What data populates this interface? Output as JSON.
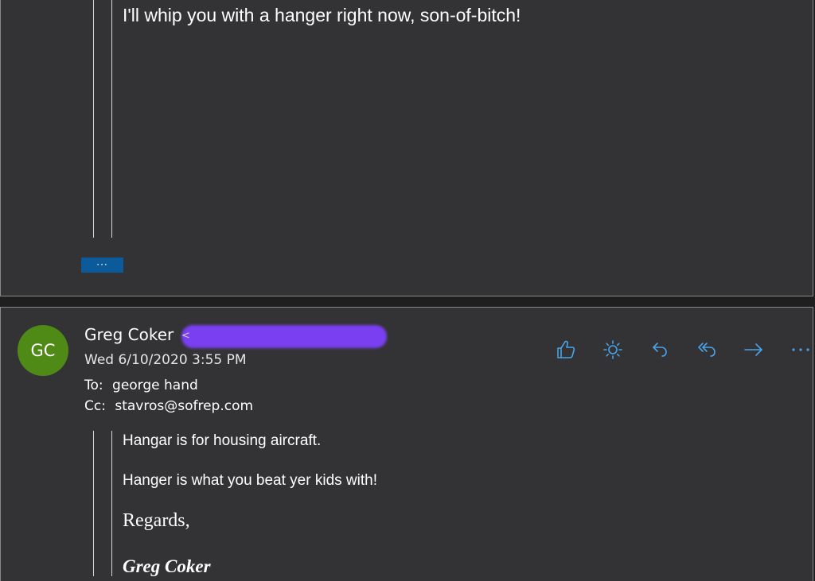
{
  "previous_message": {
    "quoted_text": "I'll whip you with a hanger right now, son-of-bitch!",
    "show_more_label": "···"
  },
  "message": {
    "avatar_initials": "GC",
    "sender_name": "Greg Coker",
    "sender_email_caret": "<",
    "date": "Wed 6/10/2020 3:55 PM",
    "to_label": "To:",
    "to_value": "george hand",
    "cc_label": "Cc:",
    "cc_value": "stavros@sofrep.com",
    "actions": {
      "like": "like-icon",
      "sun": "sun-icon",
      "reply": "reply-icon",
      "reply_all": "reply-all-icon",
      "forward": "forward-icon",
      "more": "more-icon",
      "icon_color": "#4aa3e8"
    },
    "body": {
      "line1": "Hangar is for housing aircraft.",
      "line2": "Hanger is what you beat yer kids with!",
      "regards": "Regards,",
      "signature_name": "Greg Coker"
    }
  },
  "colors": {
    "card_background": "#333335",
    "avatar": "#4f8a17",
    "button": "#0b5a9a",
    "redaction": "#7a3ff0"
  }
}
